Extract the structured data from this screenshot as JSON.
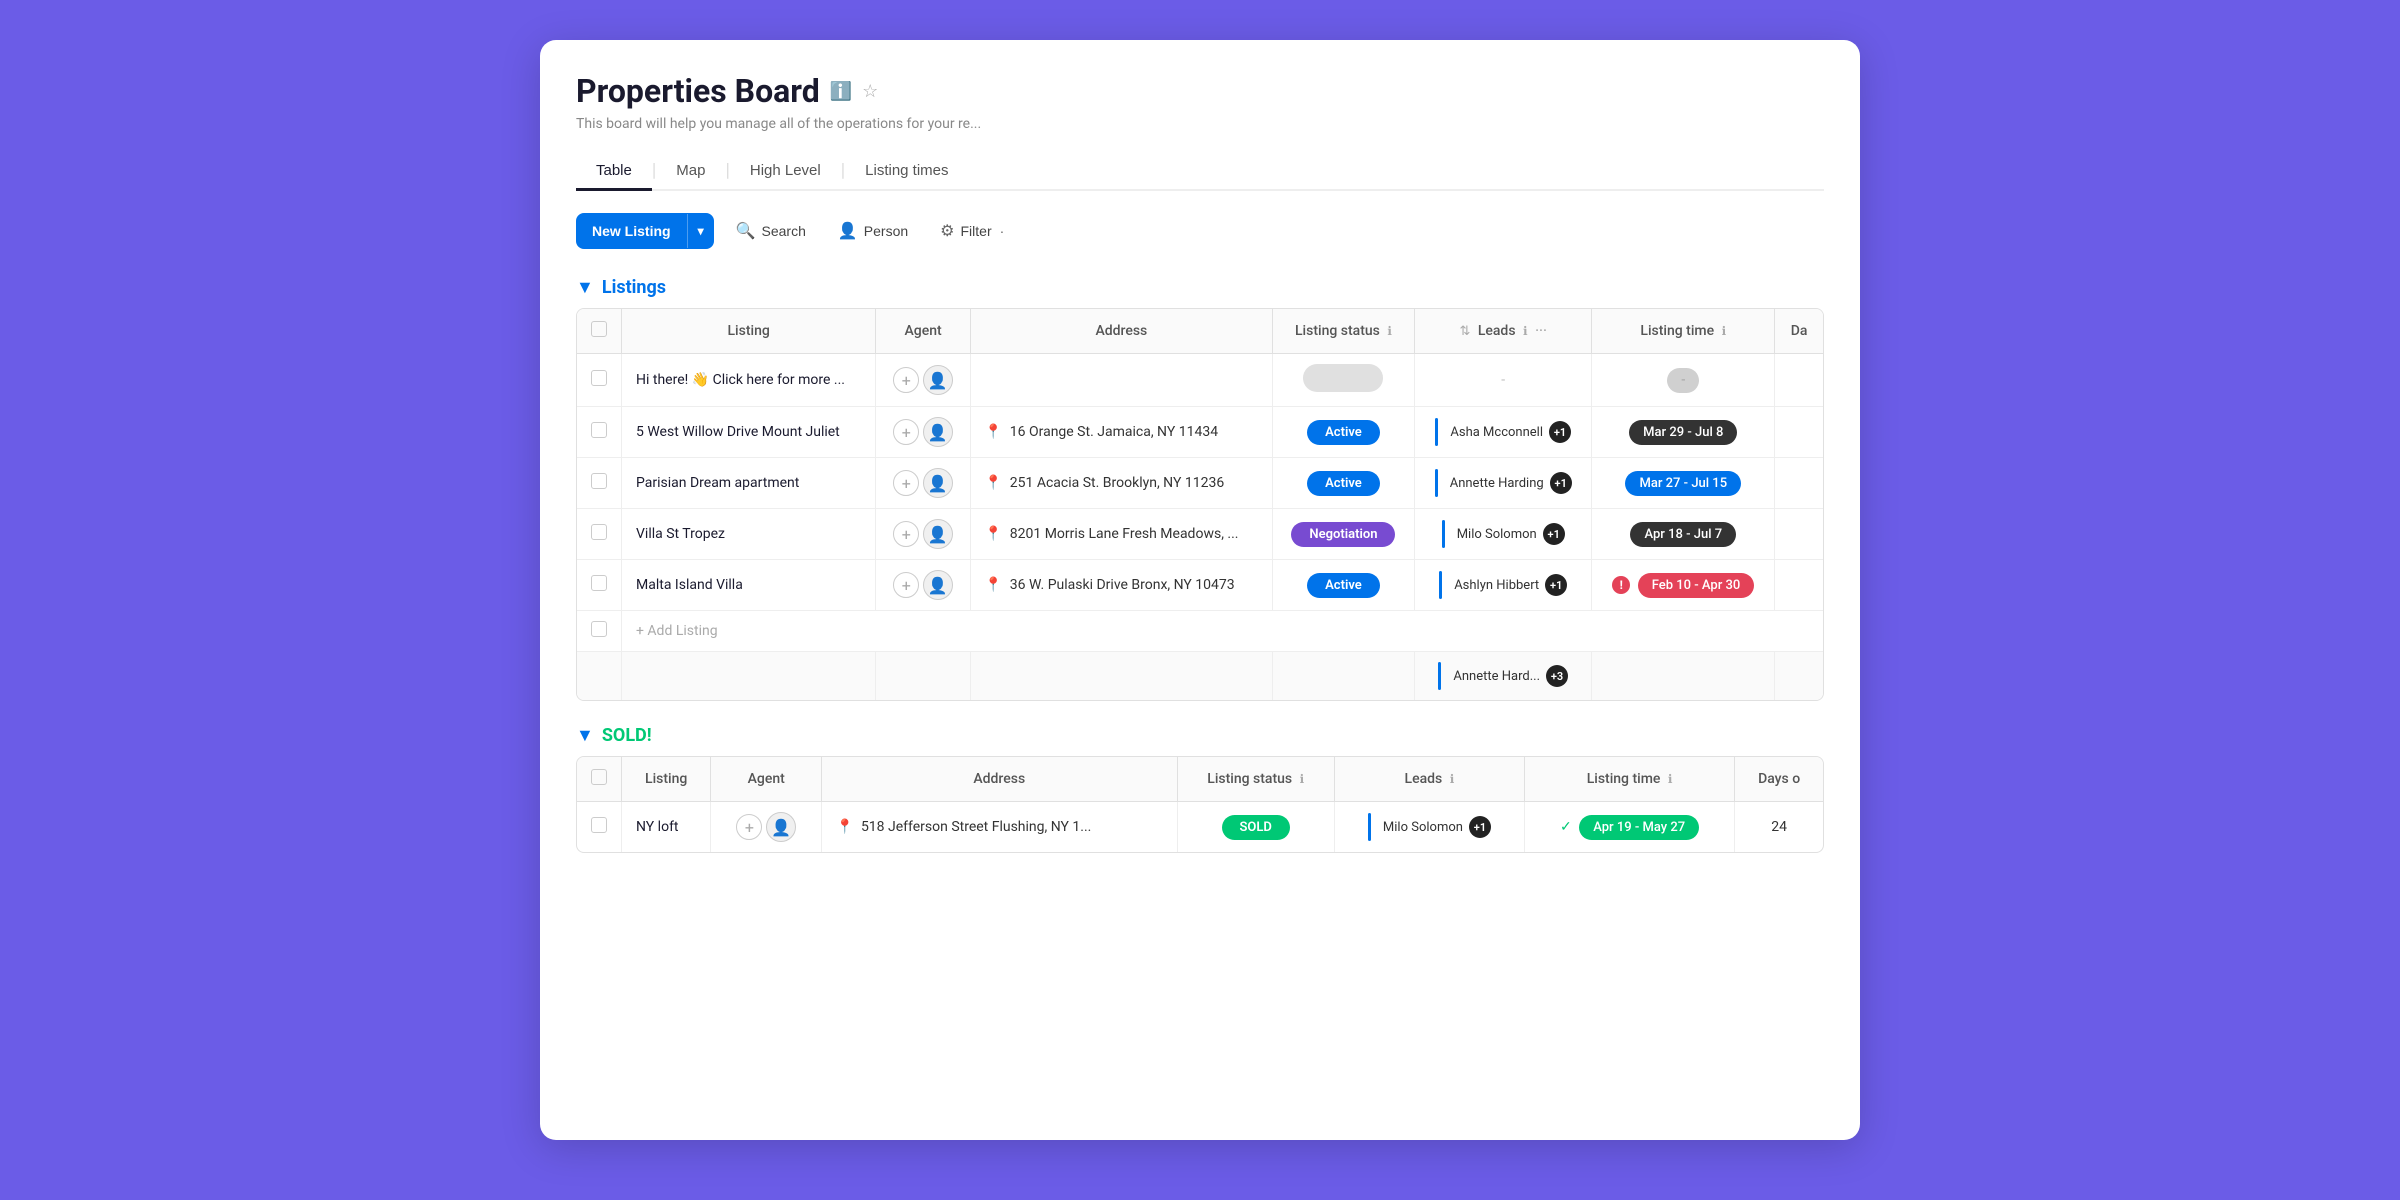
{
  "board": {
    "title": "Properties Board",
    "description": "This board will help you manage all of the operations for your re...",
    "info_icon": "ℹ",
    "star_icon": "☆"
  },
  "tabs": [
    {
      "label": "Table",
      "active": true
    },
    {
      "label": "Map",
      "active": false
    },
    {
      "label": "High Level",
      "active": false
    },
    {
      "label": "Listing times",
      "active": false
    }
  ],
  "toolbar": {
    "new_listing_label": "New Listing",
    "dropdown_icon": "▾",
    "search_label": "Search",
    "person_label": "Person",
    "filter_label": "Filter"
  },
  "sections": {
    "listings": {
      "title": "Listings",
      "columns": [
        "Listing",
        "Agent",
        "Address",
        "Listing status",
        "Leads",
        "Listing time",
        "Da"
      ],
      "rows": [
        {
          "listing": "Hi there! 👋 Click here for more ...",
          "agent": "",
          "address": "",
          "status": "",
          "leads_name": "-",
          "leads_count": "",
          "listing_time": "-",
          "time_color": "gray",
          "days": ""
        },
        {
          "listing": "5 West Willow Drive Mount Juliet",
          "agent": "",
          "address": "16 Orange St. Jamaica, NY 11434",
          "status": "Active",
          "status_type": "active",
          "leads_name": "Asha Mcconnell",
          "leads_count": "+1",
          "listing_time": "Mar 29 - Jul 8",
          "time_color": "dark",
          "days": ""
        },
        {
          "listing": "Parisian Dream apartment",
          "agent": "",
          "address": "251 Acacia St. Brooklyn, NY 11236",
          "status": "Active",
          "status_type": "active",
          "leads_name": "Annette Harding",
          "leads_count": "+1",
          "listing_time": "Mar 27 - Jul 15",
          "time_color": "blue",
          "days": ""
        },
        {
          "listing": "Villa St Tropez",
          "agent": "",
          "address": "8201 Morris Lane Fresh Meadows, ...",
          "status": "Negotiation",
          "status_type": "negotiation",
          "leads_name": "Milo Solomon",
          "leads_count": "+1",
          "listing_time": "Apr 18 - Jul 7",
          "time_color": "dark",
          "days": ""
        },
        {
          "listing": "Malta Island Villa",
          "agent": "",
          "address": "36 W. Pulaski Drive Bronx, NY 10473",
          "status": "Active",
          "status_type": "active",
          "leads_name": "Ashlyn Hibbert",
          "leads_count": "+1",
          "listing_time": "Feb 10 - Apr 30",
          "time_color": "red",
          "days": "",
          "warning": true
        }
      ],
      "add_label": "+ Add Listing",
      "summary_leads": "Annette Hard...",
      "summary_leads_count": "+3"
    },
    "sold": {
      "title": "SOLD!",
      "columns": [
        "Listing",
        "Agent",
        "Address",
        "Listing status",
        "Leads",
        "Listing time",
        "Days o"
      ],
      "rows": [
        {
          "listing": "NY loft",
          "agent": "",
          "address": "518 Jefferson Street Flushing, NY 1...",
          "status": "SOLD",
          "status_type": "sold",
          "leads_name": "Milo Solomon",
          "leads_count": "+1",
          "listing_time": "Apr 19 - May 27",
          "time_color": "green",
          "days": "24"
        }
      ]
    }
  }
}
